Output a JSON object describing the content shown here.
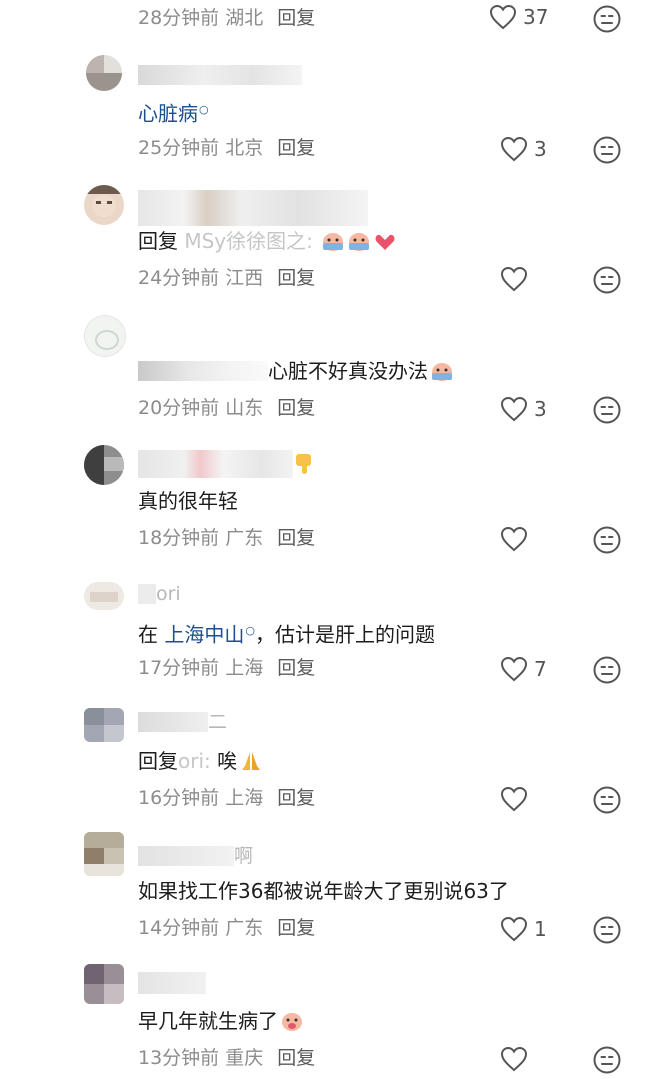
{
  "comments": [
    {
      "id": "c0",
      "time": "28分钟前",
      "location": "湖北",
      "reply_label": "回复",
      "likes": "37"
    },
    {
      "id": "c1",
      "name": "",
      "body_link": "心脏病",
      "time": "25分钟前",
      "location": "北京",
      "reply_label": "回复",
      "likes": "3"
    },
    {
      "id": "c2",
      "name": "",
      "body_prefix": "回复",
      "body_blur": "MSy徐徐图之:",
      "time": "24分钟前",
      "location": "江西",
      "reply_label": "回复",
      "likes": ""
    },
    {
      "id": "c3",
      "name": "",
      "body_text": "心脏不好真没办法",
      "time": "20分钟前",
      "location": "山东",
      "reply_label": "回复",
      "likes": "3"
    },
    {
      "id": "c4",
      "name": "",
      "body_text": "真的很年轻",
      "time": "18分钟前",
      "location": "广东",
      "reply_label": "回复",
      "likes": ""
    },
    {
      "id": "c5",
      "name": "ori",
      "body_prefix": "在",
      "body_link": "上海中山",
      "body_suffix": "，估计是肝上的问题",
      "time": "17分钟前",
      "location": "上海",
      "reply_label": "回复",
      "likes": "7"
    },
    {
      "id": "c6",
      "name": "二",
      "body_prefix": "回复",
      "body_blur": "ori:",
      "body_suffix": "唉",
      "time": "16分钟前",
      "location": "上海",
      "reply_label": "回复",
      "likes": ""
    },
    {
      "id": "c7",
      "name": "啊",
      "body_text": "如果找工作36都被说年龄大了更别说63了",
      "time": "14分钟前",
      "location": "广东",
      "reply_label": "回复",
      "likes": "1"
    },
    {
      "id": "c8",
      "name": "",
      "body_text": "早几年就生病了",
      "time": "13分钟前",
      "location": "重庆",
      "reply_label": "回复",
      "likes": ""
    }
  ]
}
